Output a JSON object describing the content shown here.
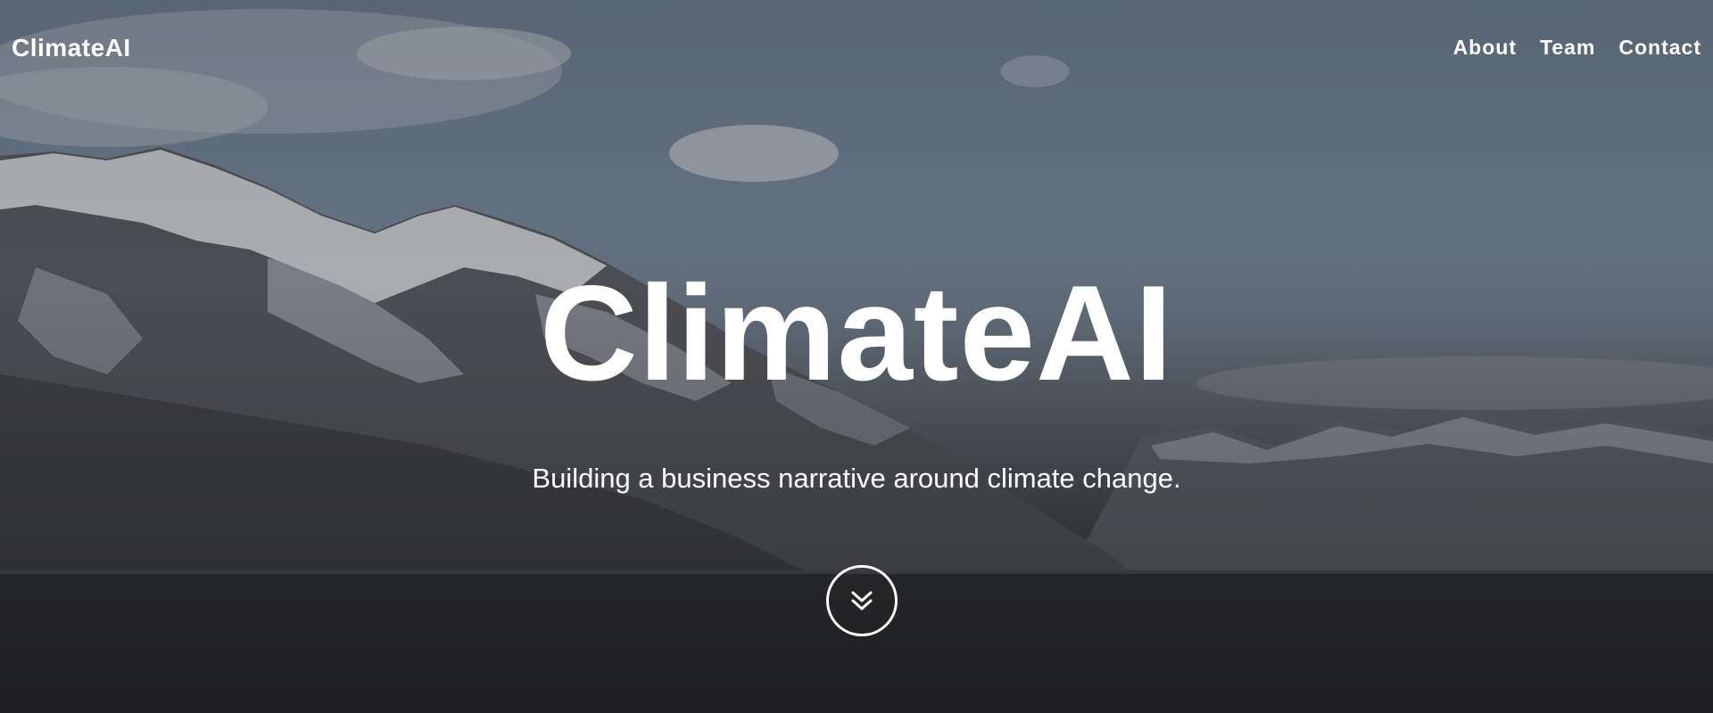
{
  "header": {
    "brand": "ClimateAI",
    "nav": [
      {
        "label": "About"
      },
      {
        "label": "Team"
      },
      {
        "label": "Contact"
      }
    ]
  },
  "hero": {
    "title": "ClimateAI",
    "subtitle": "Building a business narrative around climate change.",
    "background_image": "snowy-mountains-photo",
    "scroll_icon": "double-chevron-down-icon"
  },
  "colors": {
    "text": "#ffffff",
    "sky": "#637181",
    "mountain": "#3a3c40",
    "water": "#2d2e30"
  }
}
